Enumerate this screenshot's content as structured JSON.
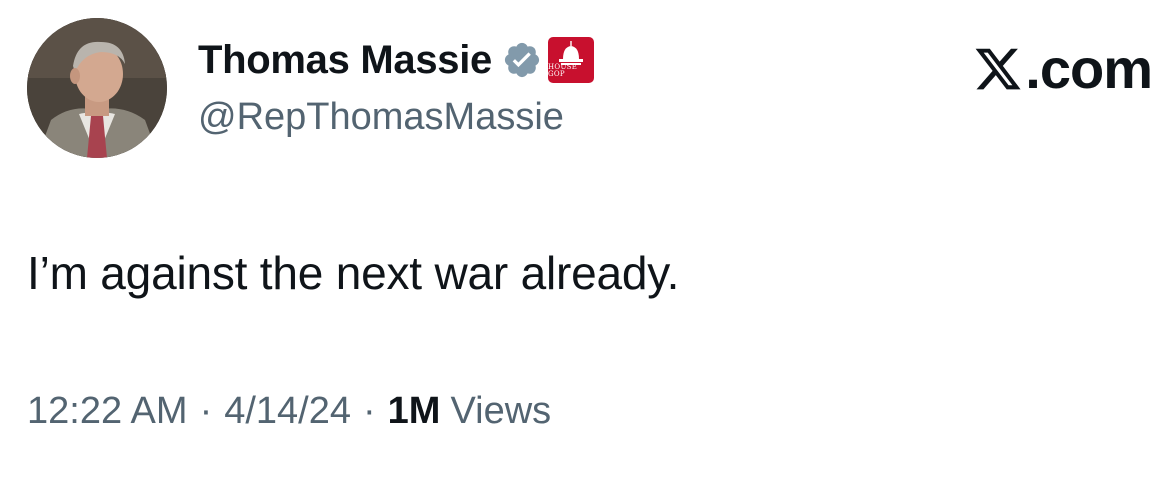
{
  "author": {
    "display_name": "Thomas Massie",
    "handle": "@RepThomasMassie",
    "avatar_icon": "profile-photo",
    "verified_color": "#829aab",
    "affiliation_badge_text": "HOUSE GOP",
    "affiliation_badge_color": "#c8102e"
  },
  "brand": {
    "text": ".com",
    "icon": "x-logo-icon"
  },
  "tweet": {
    "text": "I’m against the next war already."
  },
  "meta": {
    "time": "12:22 AM",
    "date": "4/14/24",
    "separator": "·",
    "views_count": "1M",
    "views_label": "Views"
  }
}
